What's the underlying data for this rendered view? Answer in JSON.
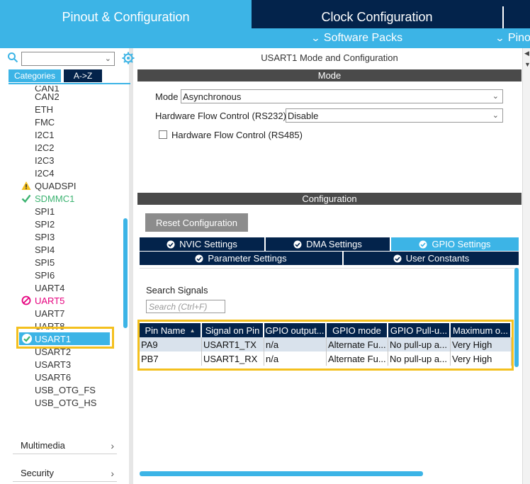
{
  "top_tabs": {
    "pinout": "Pinout & Configuration",
    "clock": "Clock Configuration"
  },
  "sub_menu": {
    "software_packs": "Software Packs",
    "pinout": "Pino"
  },
  "left": {
    "search_value": "",
    "categories_tab": "Categories",
    "az_tab": "A->Z",
    "peripherals": [
      {
        "label": "CAN1",
        "status": "none"
      },
      {
        "label": "CAN2",
        "status": "none"
      },
      {
        "label": "ETH",
        "status": "none"
      },
      {
        "label": "FMC",
        "status": "none"
      },
      {
        "label": "I2C1",
        "status": "none"
      },
      {
        "label": "I2C2",
        "status": "none"
      },
      {
        "label": "I2C3",
        "status": "none"
      },
      {
        "label": "I2C4",
        "status": "none"
      },
      {
        "label": "QUADSPI",
        "status": "warning"
      },
      {
        "label": "SDMMC1",
        "status": "ok"
      },
      {
        "label": "SPI1",
        "status": "none"
      },
      {
        "label": "SPI2",
        "status": "none"
      },
      {
        "label": "SPI3",
        "status": "none"
      },
      {
        "label": "SPI4",
        "status": "none"
      },
      {
        "label": "SPI5",
        "status": "none"
      },
      {
        "label": "SPI6",
        "status": "none"
      },
      {
        "label": "UART4",
        "status": "none"
      },
      {
        "label": "UART5",
        "status": "disabled"
      },
      {
        "label": "UART7",
        "status": "none"
      },
      {
        "label": "UART8",
        "status": "none"
      },
      {
        "label": "USART1",
        "status": "selected"
      },
      {
        "label": "USART2",
        "status": "none"
      },
      {
        "label": "USART3",
        "status": "none"
      },
      {
        "label": "USART6",
        "status": "none"
      },
      {
        "label": "USB_OTG_FS",
        "status": "none"
      },
      {
        "label": "USB_OTG_HS",
        "status": "none"
      }
    ],
    "groups": [
      "Multimedia",
      "Security"
    ]
  },
  "right": {
    "title": "USART1 Mode and Configuration",
    "mode_header": "Mode",
    "mode_label": "Mode",
    "mode_value": "Asynchronous",
    "hwfc_label": "Hardware Flow Control (RS232)",
    "hwfc_value": "Disable",
    "rs485_label": "Hardware Flow Control (RS485)",
    "rs485_checked": false,
    "config_header": "Configuration",
    "reset_button": "Reset Configuration",
    "tabs_row1": [
      "NVIC Settings",
      "DMA Settings",
      "GPIO Settings"
    ],
    "tabs_row2": [
      "Parameter Settings",
      "User Constants"
    ],
    "active_tab": "GPIO Settings",
    "search_signals_label": "Search Signals",
    "search_signals_placeholder": "Search (Ctrl+F)",
    "table": {
      "headers": [
        "Pin Name",
        "Signal on Pin",
        "GPIO output...",
        "GPIO mode",
        "GPIO Pull-u...",
        "Maximum o..."
      ],
      "rows": [
        [
          "PA9",
          "USART1_TX",
          "n/a",
          "Alternate Fu...",
          "No pull-up a...",
          "Very High"
        ],
        [
          "PB7",
          "USART1_RX",
          "n/a",
          "Alternate Fu...",
          "No pull-up a...",
          "Very High"
        ]
      ]
    }
  },
  "colors": {
    "accent": "#3cb4e6",
    "navy": "#03234b",
    "highlight": "#f4c01e",
    "ok": "#3cb371",
    "warn": "#f4c01e",
    "error": "#e6007e"
  }
}
